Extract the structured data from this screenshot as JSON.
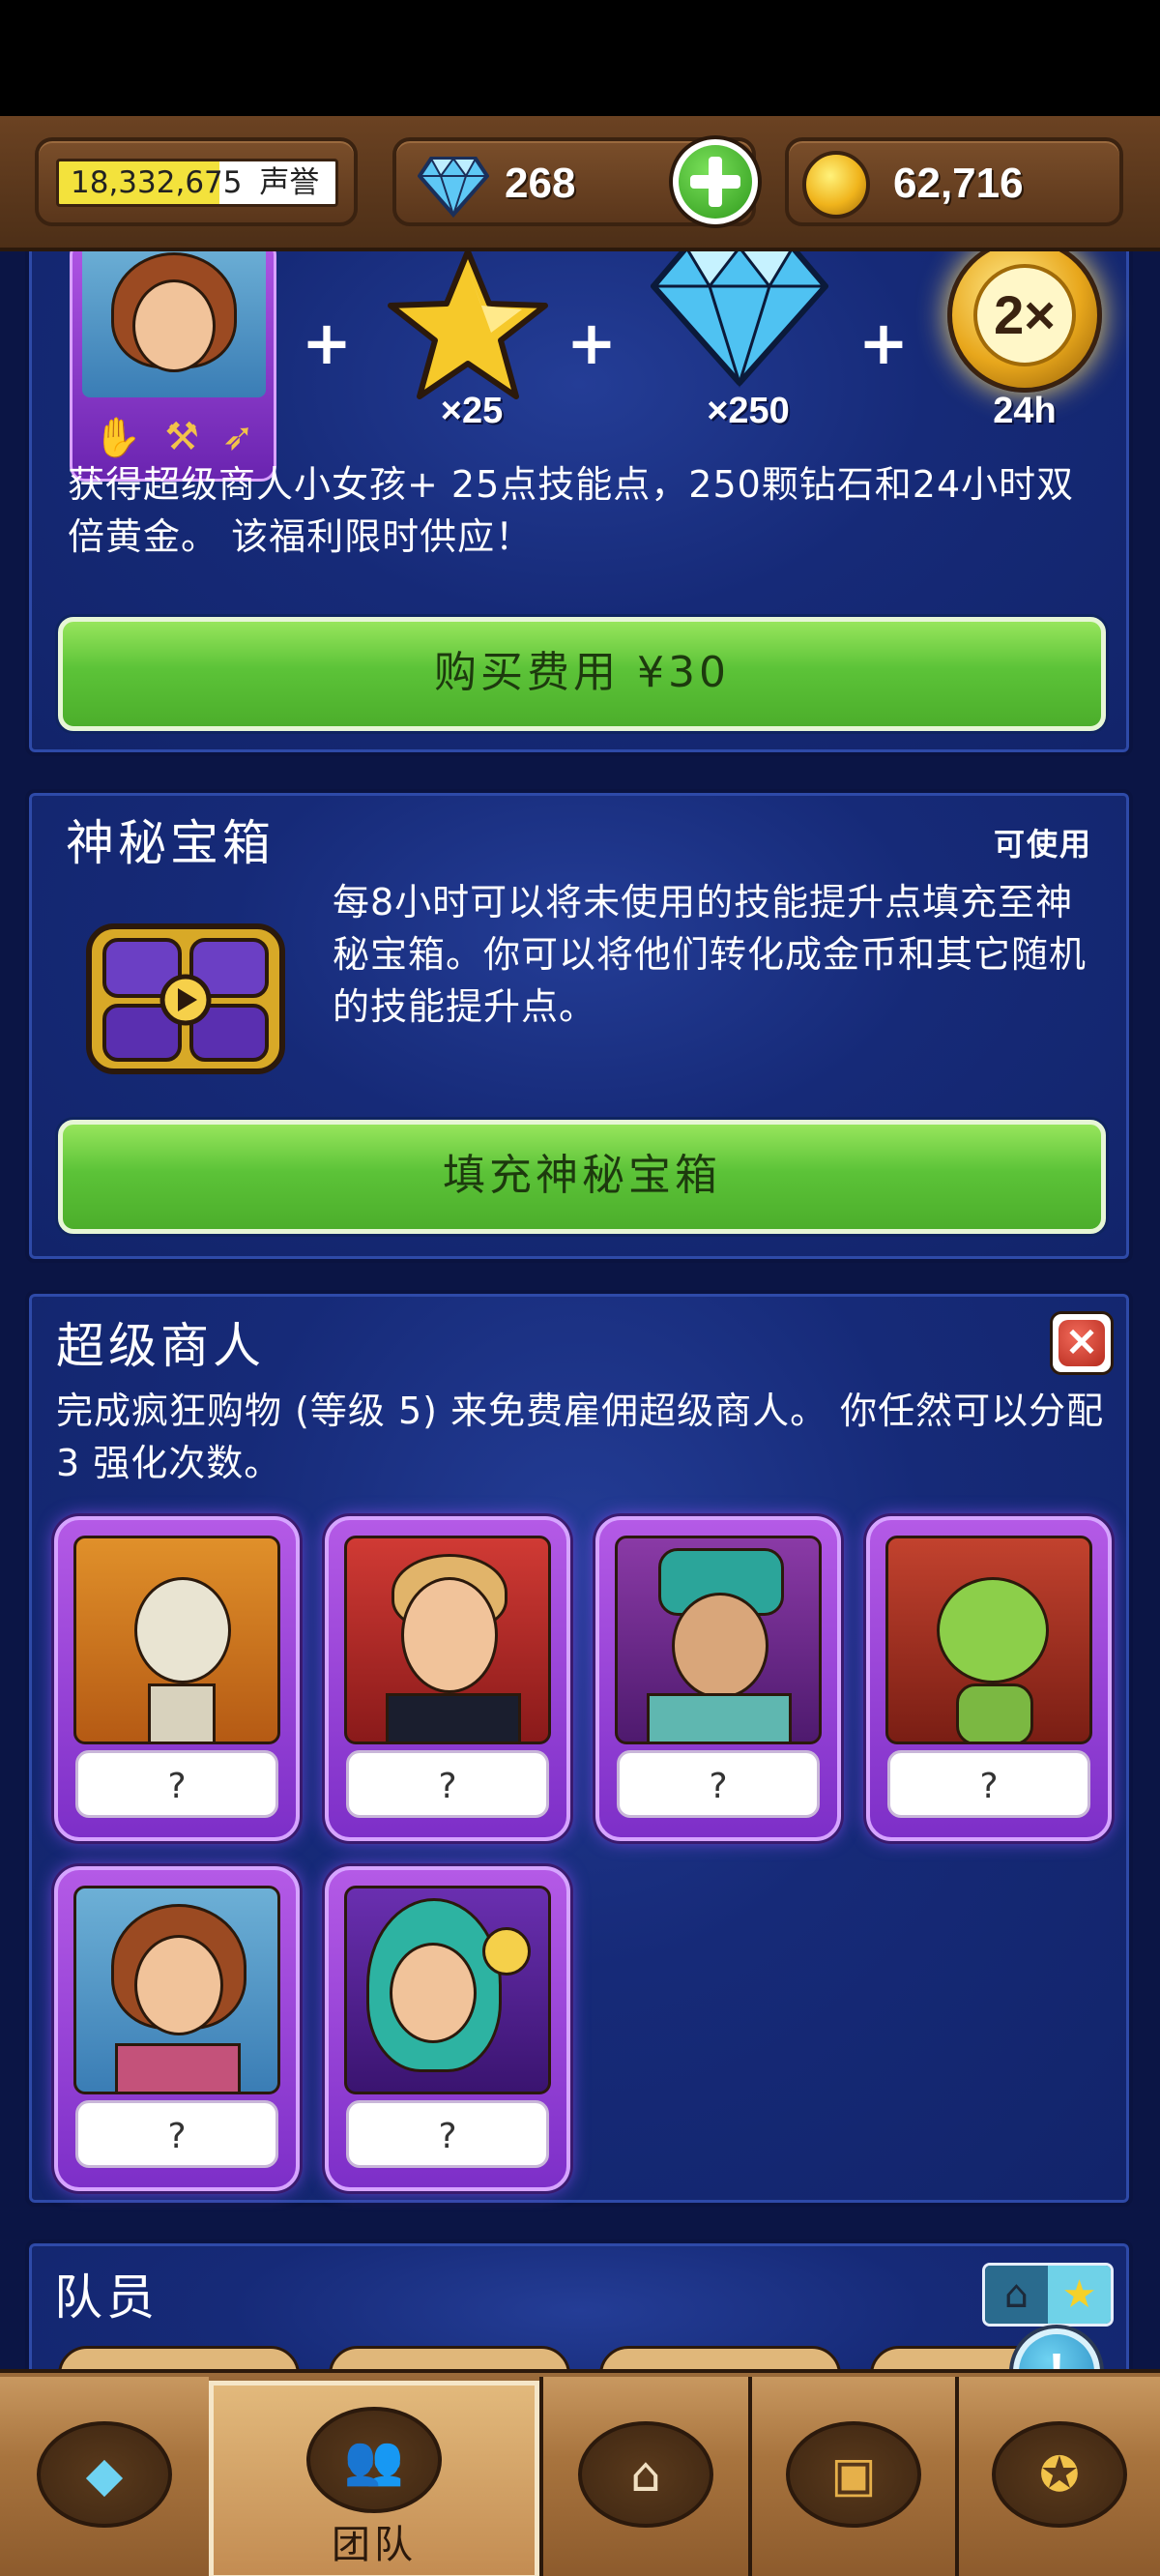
{
  "top_bar": {
    "reputation_value": "18,332,675",
    "reputation_label": "声誉",
    "gems_value": "268",
    "gold_value": "62,716"
  },
  "offer_panel": {
    "star_label": "×25",
    "gem_label": "×250",
    "double_gold_badge": "2×",
    "double_gold_label": "24h",
    "description": "获得超级商人小女孩+ 25点技能点，250颗钻石和24小时双倍黄金。 该福利限时供应！",
    "buy_button": "购买费用 ¥30"
  },
  "mystery_chest": {
    "title": "神秘宝箱",
    "status": "可使用",
    "description": "每8小时可以将未使用的技能提升点填充至神秘宝箱。你可以将他们转化成金币和其它随机的技能提升点。",
    "fill_button": "填充神秘宝箱"
  },
  "super_merchants": {
    "title": "超级商人",
    "description": "完成疯狂购物 (等级 5) 来免费雇佣超级商人。 你任然可以分配3 强化次数。",
    "cards": [
      {
        "name": "skeleton",
        "label": "?"
      },
      {
        "name": "gentleman",
        "label": "?"
      },
      {
        "name": "sage",
        "label": "?"
      },
      {
        "name": "goblin",
        "label": "?"
      },
      {
        "name": "girl",
        "label": "?"
      },
      {
        "name": "elf",
        "label": "?"
      }
    ]
  },
  "team": {
    "title": "队员"
  },
  "bottom_nav": {
    "tabs": [
      {
        "icon": "gem-icon",
        "label": ""
      },
      {
        "icon": "team-icon",
        "label": "团队"
      },
      {
        "icon": "shop-icon",
        "label": ""
      },
      {
        "icon": "chest-icon",
        "label": ""
      },
      {
        "icon": "medal-icon",
        "label": ""
      }
    ]
  },
  "hint_button": "!",
  "colors": {
    "panel_blue": "#162a78",
    "button_green": "#5cc338",
    "card_purple": "#8e3fd4",
    "wood": "#7a4e2a"
  }
}
